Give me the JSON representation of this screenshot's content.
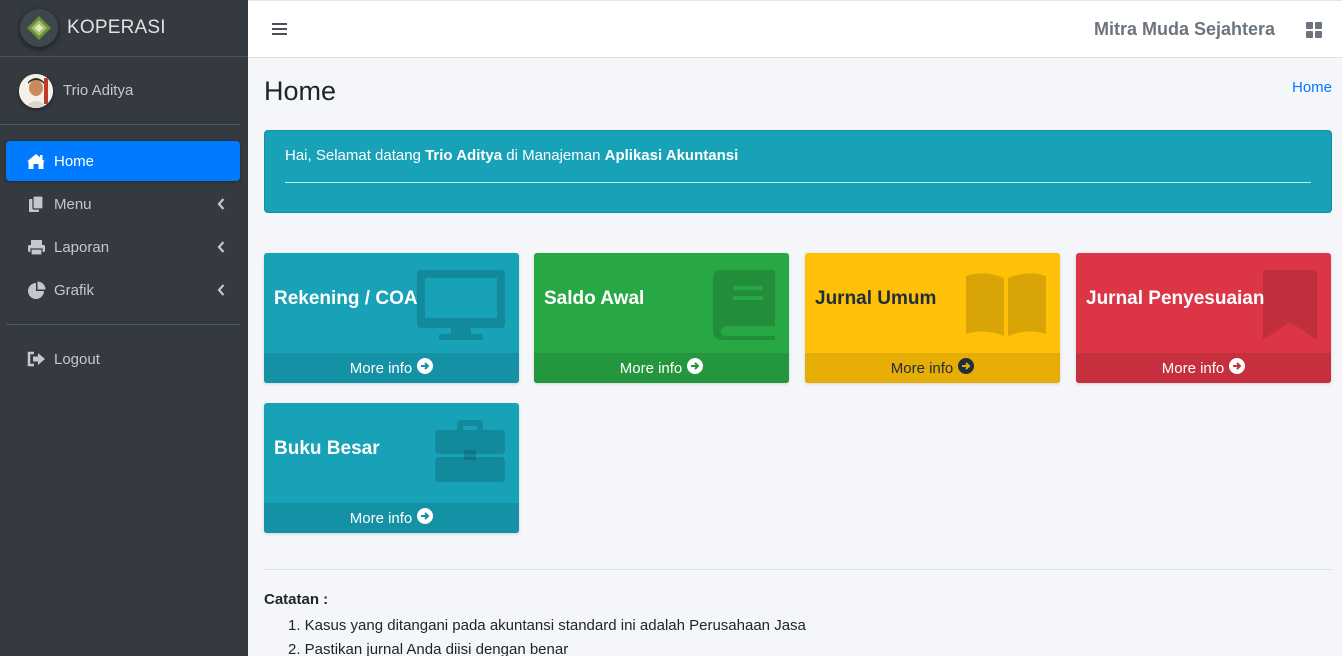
{
  "brand": {
    "name": "KOPERASI"
  },
  "user": {
    "name": "Trio Aditya"
  },
  "sidebar": {
    "items": [
      {
        "label": "Home",
        "icon": "home-icon"
      },
      {
        "label": "Menu",
        "icon": "copy-icon"
      },
      {
        "label": "Laporan",
        "icon": "print-icon"
      },
      {
        "label": "Grafik",
        "icon": "pie-chart-icon"
      },
      {
        "label": "Logout",
        "icon": "sign-out-icon"
      }
    ]
  },
  "header": {
    "company": "Mitra Muda Sejahtera"
  },
  "page": {
    "title": "Home",
    "breadcrumb": "Home"
  },
  "welcome": {
    "prefix": "Hai, Selamat datang ",
    "user": "Trio Aditya",
    "middle": " di Manajeman ",
    "app": "Aplikasi Akuntansi"
  },
  "boxes": [
    {
      "title": "Rekening / COA",
      "footer": "More info",
      "icon": "desktop-icon",
      "color": "#17a2b8"
    },
    {
      "title": "Saldo Awal",
      "footer": "More info",
      "icon": "book-icon",
      "color": "#28a745"
    },
    {
      "title": "Jurnal Umum",
      "footer": "More info",
      "icon": "open-book-icon",
      "color": "#ffc107"
    },
    {
      "title": "Jurnal Penyesuaian",
      "footer": "More info",
      "icon": "bookmark-icon",
      "color": "#dc3545"
    },
    {
      "title": "Buku Besar",
      "footer": "More info",
      "icon": "briefcase-icon",
      "color": "#17a2b8"
    }
  ],
  "notes": {
    "title": "Catatan :",
    "items": [
      "1. Kasus yang ditangani pada akuntansi standard ini adalah Perusahaan Jasa",
      "2. Pastikan jurnal Anda diisi dengan benar"
    ]
  }
}
